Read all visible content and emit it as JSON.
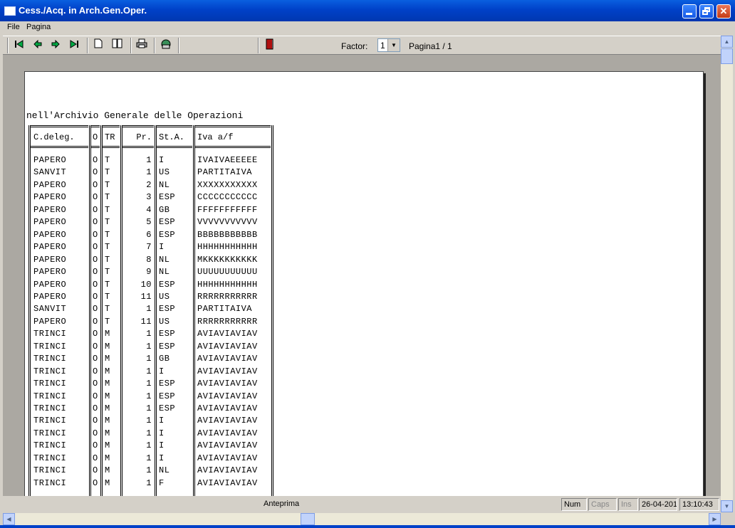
{
  "window": {
    "title": "Cess./Acq. in Arch.Gen.Oper."
  },
  "menu": [
    "File",
    "Pagina"
  ],
  "toolbar": {
    "factor_label": "Factor:",
    "factor_value": "1",
    "page_label": "Pagina1 / 1",
    "icons": [
      "first-page-icon",
      "prev-page-icon",
      "next-page-icon",
      "last-page-icon",
      "single-page-icon",
      "two-pages-icon",
      "print-icon",
      "export-icon",
      "exit-door-icon"
    ]
  },
  "report": {
    "title": "nell'Archivio Generale delle Operazioni",
    "columns": [
      "C.deleg.",
      "O",
      "TR",
      "Pr.",
      "St.A.",
      "Iva a/f"
    ],
    "rows": [
      [
        "PAPERO",
        "O",
        "T",
        "1",
        "I",
        "IVAIVAEEEEE"
      ],
      [
        "SANVIT",
        "O",
        "T",
        "1",
        "US",
        "PARTITAIVA"
      ],
      [
        "PAPERO",
        "O",
        "T",
        "2",
        "NL",
        "XXXXXXXXXXX"
      ],
      [
        "PAPERO",
        "O",
        "T",
        "3",
        "ESP",
        "CCCCCCCCCCC"
      ],
      [
        "PAPERO",
        "O",
        "T",
        "4",
        "GB",
        "FFFFFFFFFFF"
      ],
      [
        "PAPERO",
        "O",
        "T",
        "5",
        "ESP",
        "VVVVVVVVVVV"
      ],
      [
        "PAPERO",
        "O",
        "T",
        "6",
        "ESP",
        "BBBBBBBBBBB"
      ],
      [
        "PAPERO",
        "O",
        "T",
        "7",
        "I",
        "HHHHHHHHHHH"
      ],
      [
        "PAPERO",
        "O",
        "T",
        "8",
        "NL",
        "MKKKKKKKKKK"
      ],
      [
        "PAPERO",
        "O",
        "T",
        "9",
        "NL",
        "UUUUUUUUUUU"
      ],
      [
        "PAPERO",
        "O",
        "T",
        "10",
        "ESP",
        "HHHHHHHHHHH"
      ],
      [
        "PAPERO",
        "O",
        "T",
        "11",
        "US",
        "RRRRRRRRRRR"
      ],
      [
        "SANVIT",
        "O",
        "T",
        "1",
        "ESP",
        "PARTITAIVA"
      ],
      [
        "PAPERO",
        "O",
        "T",
        "11",
        "US",
        "RRRRRRRRRRR"
      ],
      [
        "TRINCI",
        "O",
        "M",
        "1",
        "ESP",
        "AVIAVIAVIAV"
      ],
      [
        "TRINCI",
        "O",
        "M",
        "1",
        "ESP",
        "AVIAVIAVIAV"
      ],
      [
        "TRINCI",
        "O",
        "M",
        "1",
        "GB",
        "AVIAVIAVIAV"
      ],
      [
        "TRINCI",
        "O",
        "M",
        "1",
        "I",
        "AVIAVIAVIAV"
      ],
      [
        "TRINCI",
        "O",
        "M",
        "1",
        "ESP",
        "AVIAVIAVIAV"
      ],
      [
        "TRINCI",
        "O",
        "M",
        "1",
        "ESP",
        "AVIAVIAVIAV"
      ],
      [
        "TRINCI",
        "O",
        "M",
        "1",
        "ESP",
        "AVIAVIAVIAV"
      ],
      [
        "TRINCI",
        "O",
        "M",
        "1",
        "I",
        "AVIAVIAVIAV"
      ],
      [
        "TRINCI",
        "O",
        "M",
        "1",
        "I",
        "AVIAVIAVIAV"
      ],
      [
        "TRINCI",
        "O",
        "M",
        "1",
        "I",
        "AVIAVIAVIAV"
      ],
      [
        "TRINCI",
        "O",
        "M",
        "1",
        "I",
        "AVIAVIAVIAV"
      ],
      [
        "TRINCI",
        "O",
        "M",
        "1",
        "NL",
        "AVIAVIAVIAV"
      ],
      [
        "TRINCI",
        "O",
        "M",
        "1",
        "F",
        "AVIAVIAVIAV"
      ]
    ]
  },
  "status": {
    "center": "Anteprima",
    "num": "Num",
    "caps": "Caps",
    "ins": "Ins",
    "date": "26-04-2016",
    "time": "13:10:43"
  }
}
